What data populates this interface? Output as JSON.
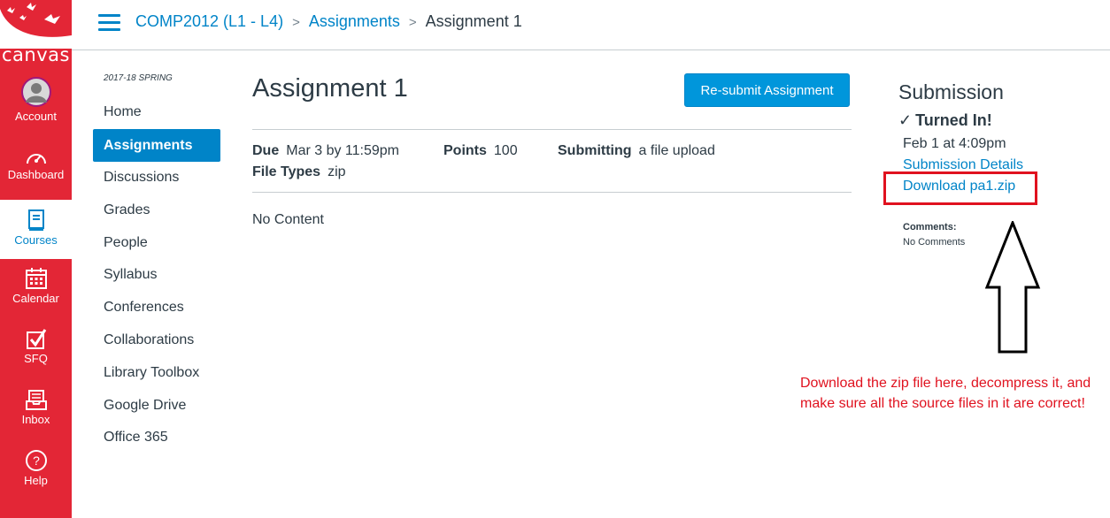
{
  "global_nav": {
    "logo_text": "canvas",
    "items": [
      {
        "label": "Account",
        "icon": "account-avatar-icon"
      },
      {
        "label": "Dashboard",
        "icon": "dashboard-gauge-icon"
      },
      {
        "label": "Courses",
        "icon": "courses-book-icon",
        "active": true
      },
      {
        "label": "Calendar",
        "icon": "calendar-icon"
      },
      {
        "label": "SFQ",
        "icon": "sfq-checkbox-icon"
      },
      {
        "label": "Inbox",
        "icon": "inbox-icon"
      },
      {
        "label": "Help",
        "icon": "help-icon"
      }
    ]
  },
  "header": {
    "breadcrumbs": [
      "COMP2012 (L1 - L4)",
      "Assignments",
      "Assignment 1"
    ]
  },
  "course_nav": {
    "term": "2017-18 SPRING",
    "items": [
      "Home",
      "Assignments",
      "Discussions",
      "Grades",
      "People",
      "Syllabus",
      "Conferences",
      "Collaborations",
      "Library Toolbox",
      "Google Drive",
      "Office 365"
    ],
    "active": "Assignments"
  },
  "assignment": {
    "title": "Assignment 1",
    "resubmit_label": "Re-submit Assignment",
    "due_label": "Due",
    "due_value": "Mar 3 by 11:59pm",
    "points_label": "Points",
    "points_value": "100",
    "submitting_label": "Submitting",
    "submitting_value": "a file upload",
    "file_types_label": "File Types",
    "file_types_value": "zip",
    "content": "No Content"
  },
  "submission": {
    "heading": "Submission",
    "status": "Turned In!",
    "date": "Feb 1 at 4:09pm",
    "details_link": "Submission Details",
    "download_link": "Download pa1.zip",
    "comments_label": "Comments:",
    "comments_value": "No Comments"
  },
  "annotation": {
    "text": "Download the zip file here, decompress it, and make sure all the source files in it are correct!"
  },
  "colors": {
    "nav_red": "#e32636",
    "link_blue": "#0084c8",
    "annotation_red": "#e0121f"
  }
}
